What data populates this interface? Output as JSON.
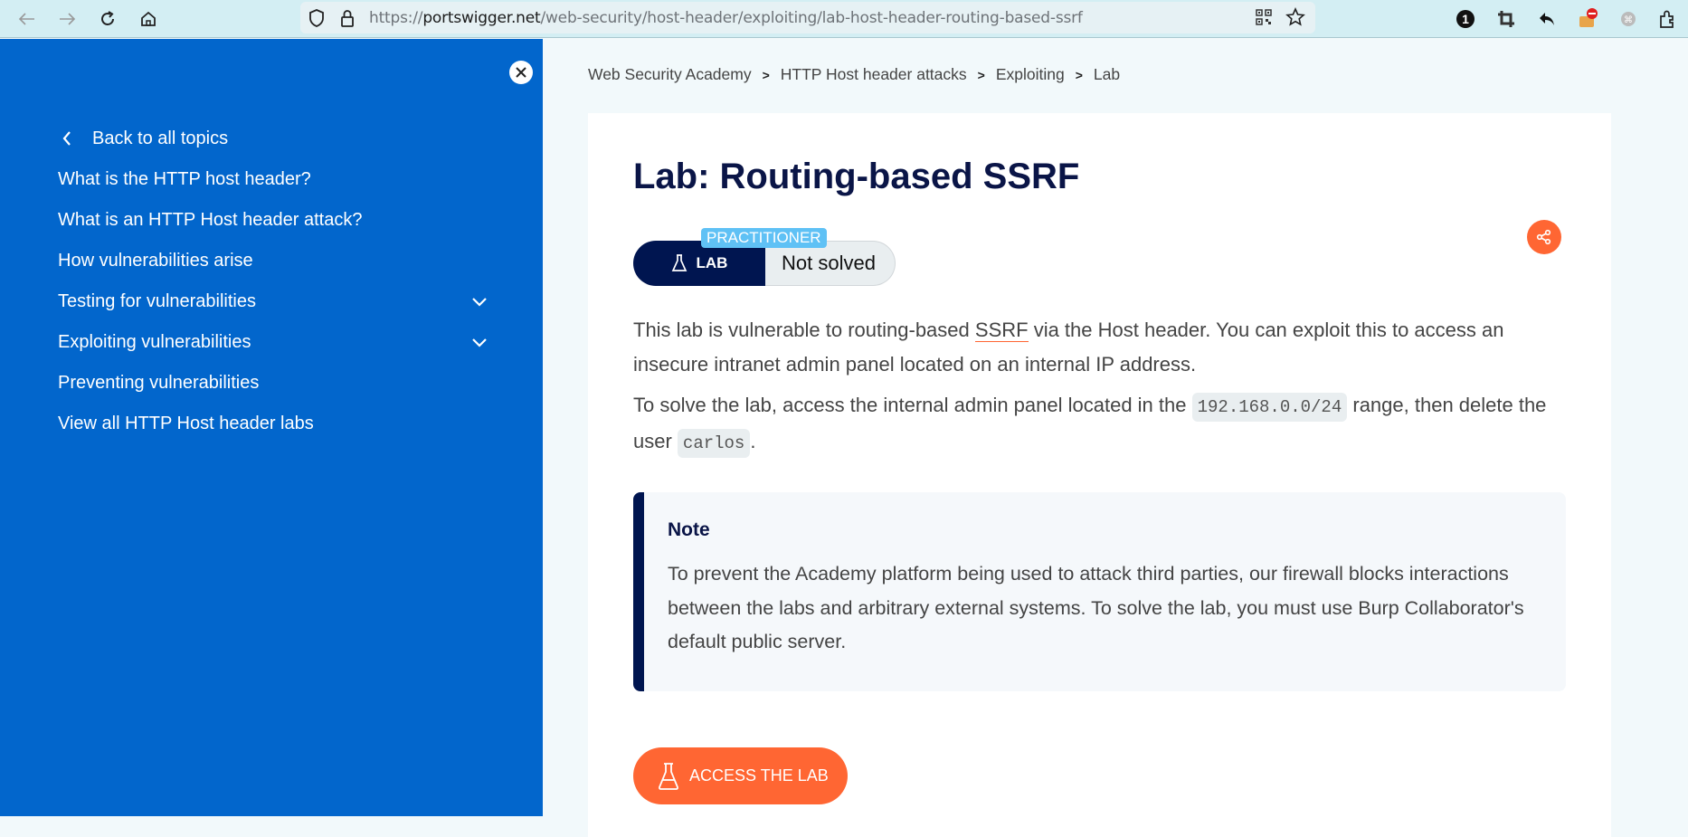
{
  "browser": {
    "url_prefix": "https://",
    "url_domain": "portswigger.net",
    "url_path": "/web-security/host-header/exploiting/lab-host-header-routing-based-ssrf",
    "icons": [
      "back-icon",
      "forward-icon",
      "reload-icon",
      "home-icon",
      "shield-icon",
      "lock-icon",
      "qr-code-icon",
      "bookmark-star-icon",
      "password-manager-icon",
      "crop-icon",
      "undo-icon",
      "extension-icon",
      "extension-gray-icon",
      "extensions-puzzle-icon"
    ]
  },
  "sidebar": {
    "back_label": "Back to all topics",
    "items": [
      {
        "label": "What is the HTTP host header?",
        "expandable": false
      },
      {
        "label": "What is an HTTP Host header attack?",
        "expandable": false
      },
      {
        "label": "How vulnerabilities arise",
        "expandable": false
      },
      {
        "label": "Testing for vulnerabilities",
        "expandable": true
      },
      {
        "label": "Exploiting vulnerabilities",
        "expandable": true
      },
      {
        "label": "Preventing vulnerabilities",
        "expandable": false
      },
      {
        "label": "View all HTTP Host header labs",
        "expandable": false
      }
    ]
  },
  "breadcrumb": [
    "Web Security Academy",
    "HTTP Host header attacks",
    "Exploiting",
    "Lab"
  ],
  "breadcrumb_separator": ">",
  "lab": {
    "title": "Lab: Routing-based SSRF",
    "badge_label": "LAB",
    "level": "PRACTITIONER",
    "status": "Not solved",
    "para1_before": "This lab is vulnerable to routing-based ",
    "para1_link": "SSRF",
    "para1_after": " via the Host header. You can exploit this to access an insecure intranet admin panel located on an internal IP address.",
    "para2_before": "To solve the lab, access the internal admin panel located in the ",
    "para2_code1": "192.168.0.0/24",
    "para2_middle": " range, then delete the user ",
    "para2_code2": "carlos",
    "para2_after": ".",
    "note_title": "Note",
    "note_body": "To prevent the Academy platform being used to attack third parties, our firewall blocks interactions between the labs and arbitrary external systems. To solve the lab, you must use Burp Collaborator's default public server.",
    "access_button": "ACCESS THE LAB"
  },
  "colors": {
    "sidebar_bg": "#0266cc",
    "accent_orange": "#ff6633",
    "navy": "#001550",
    "level_badge": "#5fc1f5"
  }
}
